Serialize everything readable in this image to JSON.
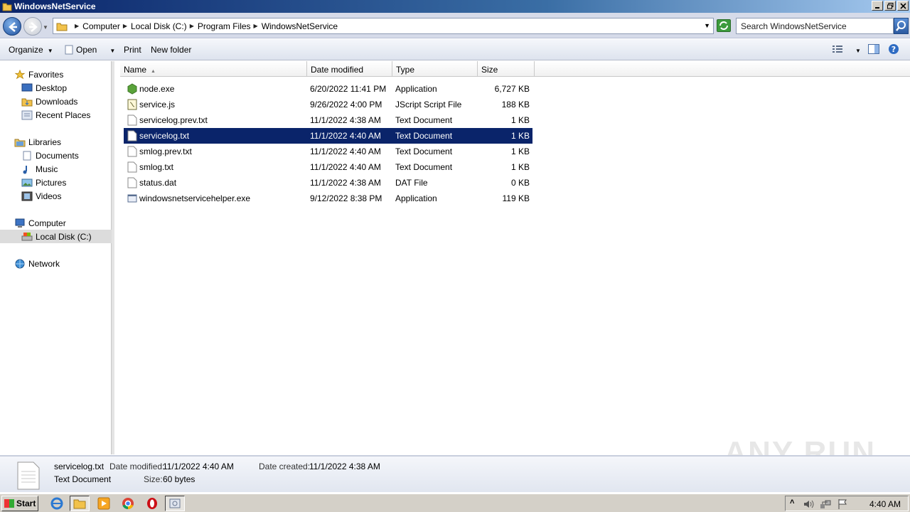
{
  "window": {
    "title": "WindowsNetService"
  },
  "address": {
    "breadcrumbs": [
      "Computer",
      "Local Disk (C:)",
      "Program Files",
      "WindowsNetService"
    ],
    "search_placeholder": "Search WindowsNetService"
  },
  "toolbar": {
    "organize": "Organize",
    "open": "Open",
    "print": "Print",
    "new_folder": "New folder"
  },
  "nav": {
    "favorites": "Favorites",
    "desktop": "Desktop",
    "downloads": "Downloads",
    "recent": "Recent Places",
    "libraries": "Libraries",
    "documents": "Documents",
    "music": "Music",
    "pictures": "Pictures",
    "videos": "Videos",
    "computer": "Computer",
    "local_disk": "Local Disk (C:)",
    "network": "Network"
  },
  "columns": {
    "name": "Name",
    "date": "Date modified",
    "type": "Type",
    "size": "Size"
  },
  "files": [
    {
      "name": "node.exe",
      "date": "6/20/2022 11:41 PM",
      "type": "Application",
      "size": "6,727 KB",
      "icon": "node-icon"
    },
    {
      "name": "service.js",
      "date": "9/26/2022 4:00 PM",
      "type": "JScript Script File",
      "size": "188 KB",
      "icon": "script-icon"
    },
    {
      "name": "servicelog.prev.txt",
      "date": "11/1/2022 4:38 AM",
      "type": "Text Document",
      "size": "1 KB",
      "icon": "text-file-icon"
    },
    {
      "name": "servicelog.txt",
      "date": "11/1/2022 4:40 AM",
      "type": "Text Document",
      "size": "1 KB",
      "icon": "text-file-icon",
      "selected": true
    },
    {
      "name": "smlog.prev.txt",
      "date": "11/1/2022 4:40 AM",
      "type": "Text Document",
      "size": "1 KB",
      "icon": "text-file-icon"
    },
    {
      "name": "smlog.txt",
      "date": "11/1/2022 4:40 AM",
      "type": "Text Document",
      "size": "1 KB",
      "icon": "text-file-icon"
    },
    {
      "name": "status.dat",
      "date": "11/1/2022 4:38 AM",
      "type": "DAT File",
      "size": "0 KB",
      "icon": "file-icon"
    },
    {
      "name": "windowsnetservicehelper.exe",
      "date": "9/12/2022 8:38 PM",
      "type": "Application",
      "size": "119 KB",
      "icon": "exe-icon"
    }
  ],
  "details": {
    "filename": "servicelog.txt",
    "filetype": "Text Document",
    "date_modified_label": "Date modified:",
    "date_modified": "11/1/2022 4:40 AM",
    "date_created_label": "Date created:",
    "date_created": "11/1/2022 4:38 AM",
    "size_label": "Size:",
    "size": "60 bytes"
  },
  "watermark": "ANY RUN",
  "taskbar": {
    "start": "Start",
    "clock": "4:40 AM"
  },
  "colors": {
    "selection": "#0a246a",
    "title_start": "#0a246a",
    "title_end": "#a6caf0"
  }
}
